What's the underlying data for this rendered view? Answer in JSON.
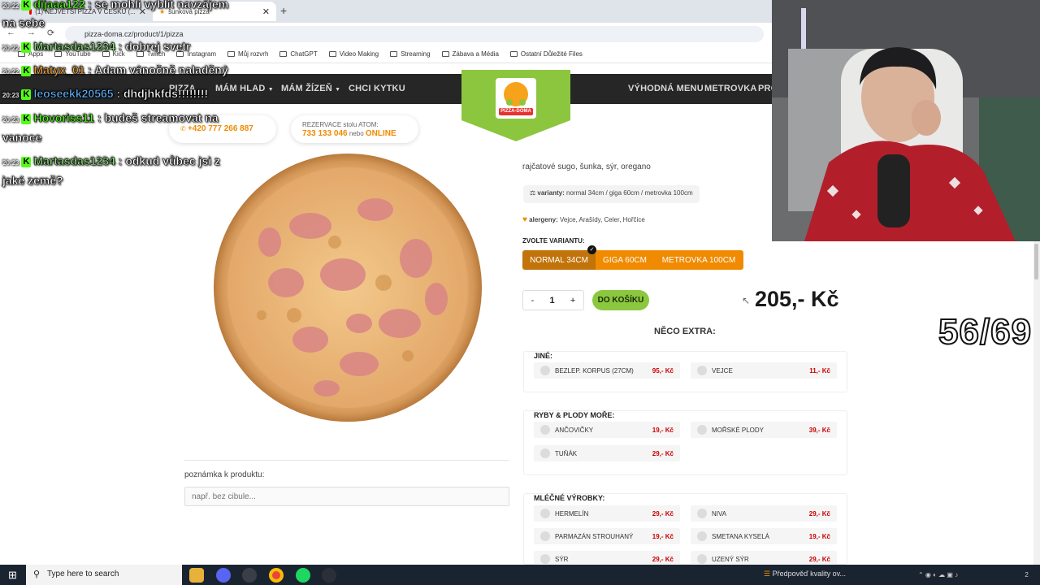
{
  "browser": {
    "tabs": [
      {
        "title": "(1) NEJVĚTŠÍ PIZZA V ČESKU (...",
        "active": false
      },
      {
        "title": "šunková pizza",
        "active": true
      }
    ],
    "new_tab": "+",
    "close": "✕",
    "url": "pizza-doma.cz/product/1/pizza",
    "bookmarks": [
      "Apps",
      "YouTube",
      "Kick",
      "Twitch",
      "Instagram",
      "Můj rozvrh",
      "ChatGPT",
      "Video Making",
      "Streaming",
      "Zábava a Média",
      "Ostatní Důležité Files"
    ]
  },
  "site": {
    "nav_left": [
      "PIZZA",
      "MÁM HLAD",
      "MÁM ŽÍZEŇ",
      "CHCI KYTKU"
    ],
    "nav_right": [
      "VÝHODNÁ MENU",
      "METROVKA",
      "PRO"
    ],
    "logo_text": "PIZZA-DOMA",
    "phone": "+420 777 266 887",
    "reservation_label": "REZERVACE stolu ATOM:",
    "reservation_phone": "733 133 046",
    "reservation_or": "nebo",
    "reservation_online": "ONLINE"
  },
  "product": {
    "description": "rajčatové sugo, šunka, sýr, oregano",
    "variants_label": "varianty:",
    "variants_text": "normal 34cm / giga 60cm / metrovka 100cm",
    "allergens_label": "alergeny:",
    "allergens_text": "Vejce, Arašídy, Celer, Hořčice",
    "choose_variant_title": "ZVOLTE VARIANTU:",
    "variant_buttons": [
      "NORMAL 34CM",
      "GIGA 60CM",
      "METROVKA 100CM"
    ],
    "selected_variant": "NORMAL 34CM",
    "qty_minus": "-",
    "qty_value": "1",
    "qty_plus": "+",
    "add_to_cart": "DO KOŠÍKU",
    "price": "205,- Kč",
    "extras_title": "NĚCO EXTRA:",
    "note_label": "poznámka k produktu:",
    "note_placeholder": "např. bez cibule..."
  },
  "extras": [
    {
      "title": "JINÉ:",
      "items": [
        {
          "name": "BEZLEP. KORPUS (27CM)",
          "price": "95,- Kč"
        },
        {
          "name": "VEJCE",
          "price": "11,- Kč"
        }
      ]
    },
    {
      "title": "RYBY & PLODY MOŘE:",
      "items": [
        {
          "name": "ANČOVIČKY",
          "price": "19,- Kč"
        },
        {
          "name": "MOŘSKÉ PLODY",
          "price": "39,- Kč"
        },
        {
          "name": "TUŇÁK",
          "price": "29,- Kč"
        }
      ]
    },
    {
      "title": "MLÉČNÉ VÝROBKY:",
      "items": [
        {
          "name": "HERMELÍN",
          "price": "29,- Kč"
        },
        {
          "name": "NIVA",
          "price": "29,- Kč"
        },
        {
          "name": "PARMAZÁN STROUHANÝ",
          "price": "19,- Kč"
        },
        {
          "name": "SMETANA KYSELÁ",
          "price": "19,- Kč"
        },
        {
          "name": "SÝR",
          "price": "29,- Kč"
        },
        {
          "name": "UZENÝ SÝR",
          "price": "29,- Kč"
        }
      ]
    }
  ],
  "chat": [
    {
      "time": "20:22",
      "user": "dijaaa122",
      "user_color": "#53fc18",
      "text": " : se mohli vyblit navzájem"
    },
    {
      "time": "",
      "user": "",
      "user_color": "#ffffff",
      "text": "na sebe"
    },
    {
      "time": "20:22",
      "user": "Martasdas1234",
      "user_color": "#8ee07a",
      "text": " : dobrej svetr"
    },
    {
      "time": "20:22",
      "user": "Matyx_01",
      "user_color": "#f2a23a",
      "text": " : Adam vánočně naladěný"
    },
    {
      "time": "20:23",
      "user": "leoseekk20565",
      "user_color": "#5fb3ff",
      "text": " : dhdjhkfds!!!!!!!!"
    },
    {
      "time": "20:23",
      "user": "Hovoriss11",
      "user_color": "#53fc18",
      "text": " : budeš streamovat na"
    },
    {
      "time": "",
      "user": "",
      "user_color": "#ffffff",
      "text": "vanoce"
    },
    {
      "time": "20:23",
      "user": "Martasdas1234",
      "user_color": "#8ee07a",
      "text": " : odkud vůbec jsi z"
    },
    {
      "time": "",
      "user": "",
      "user_color": "#ffffff",
      "text": "jaké země?"
    }
  ],
  "overlay": {
    "counter": "56/69"
  },
  "taskbar": {
    "search_placeholder": "Type here to search",
    "weather_text": "Předpověď kvality ov...",
    "tray_text": "2"
  }
}
